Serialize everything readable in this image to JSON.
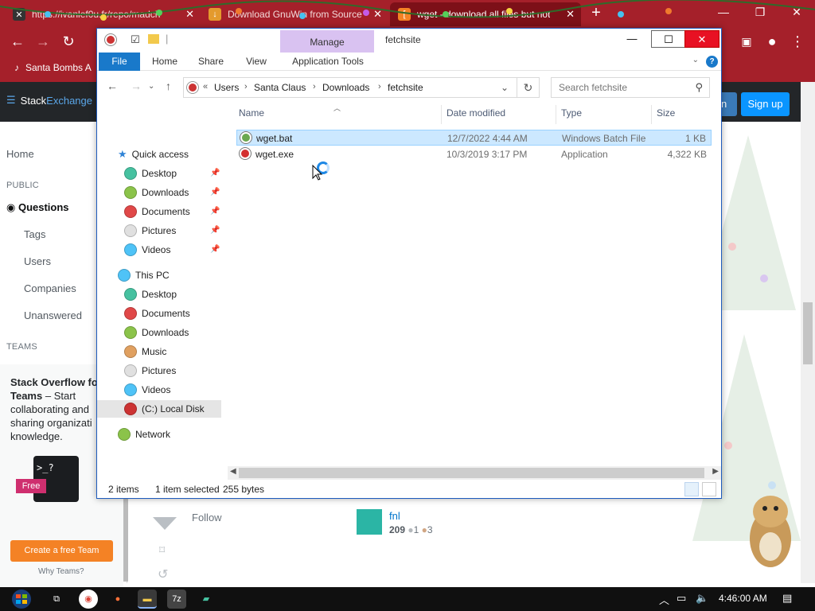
{
  "browser": {
    "tabs": [
      {
        "label": "https://ivanlef0u.fr/repo/madch",
        "active": false
      },
      {
        "label": "Download GnuWin from Source",
        "active": false
      },
      {
        "label": "wget - download all files but not",
        "active": true
      }
    ],
    "bookmark": "Santa Bombs A",
    "new_tab_glyph": "+"
  },
  "page": {
    "logo_prefix": "Stack",
    "logo_suffix": "Exchange",
    "signup": "Sign up",
    "login_edge": "n",
    "nav": {
      "home": "Home",
      "public": "PUBLIC",
      "questions": "Questions",
      "tags": "Tags",
      "users": "Users",
      "companies": "Companies",
      "unanswered": "Unanswered",
      "teams": "TEAMS"
    },
    "teams_box": {
      "title_bold": "Stack Overflow fo",
      "title_bold2": "Teams",
      "title_rest": " – Start collaborating and sharing organizati knowledge.",
      "free": "Free",
      "terminal": ">_?",
      "create": "Create a free Team",
      "why": "Why Teams?"
    },
    "follow": "Follow",
    "answer_user": {
      "name": "fnl",
      "rep": "209",
      "silver": "1",
      "bronze": "3"
    }
  },
  "explorer": {
    "manage_tab": "Manage",
    "title": "fetchsite",
    "ribbon": [
      "File",
      "Home",
      "Share",
      "View",
      "Application Tools"
    ],
    "address": {
      "overflow": "«",
      "crumbs": [
        "Users",
        "Santa Claus",
        "Downloads",
        "fetchsite"
      ]
    },
    "search_placeholder": "Search fetchsite",
    "nav_pane": {
      "quick_access": "Quick access",
      "quick_items": [
        "Desktop",
        "Downloads",
        "Documents",
        "Pictures",
        "Videos"
      ],
      "this_pc": "This PC",
      "pc_items": [
        "Desktop",
        "Documents",
        "Downloads",
        "Music",
        "Pictures",
        "Videos",
        "(C:) Local Disk"
      ],
      "network": "Network"
    },
    "columns": [
      "Name",
      "Date modified",
      "Type",
      "Size"
    ],
    "files": [
      {
        "name": "wget.bat",
        "date": "12/7/2022 4:44 AM",
        "type": "Windows Batch File",
        "size": "1 KB",
        "selected": true
      },
      {
        "name": "wget.exe",
        "date": "10/3/2019 3:17 PM",
        "type": "Application",
        "size": "4,322 KB",
        "selected": false
      }
    ],
    "status": {
      "items": "2 items",
      "selected": "1 item selected",
      "size": "255 bytes"
    }
  },
  "taskbar": {
    "clock": "4:46:00 AM"
  },
  "colors": {
    "browser_red": "#a5202a",
    "explorer_accent": "#1979ca",
    "manage_tab": "#d9c2f1",
    "selection": "#cce8ff",
    "so_blue": "#0a95ff",
    "so_orange": "#f48225"
  }
}
